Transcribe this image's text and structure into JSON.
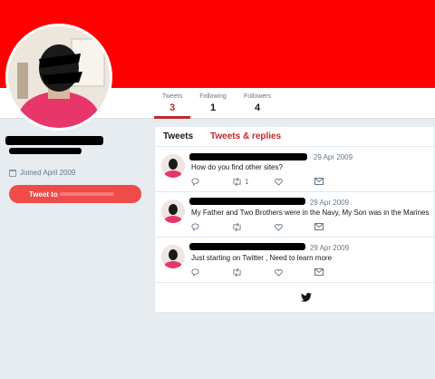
{
  "profile": {
    "joined": "Joined April 2009",
    "tweet_to_label": "Tweet to"
  },
  "nav": {
    "stats": [
      {
        "label": "Tweets",
        "value": "3"
      },
      {
        "label": "Following",
        "value": "1"
      },
      {
        "label": "Followers",
        "value": "4"
      }
    ]
  },
  "timeline": {
    "tabs": [
      "Tweets",
      "Tweets & replies"
    ],
    "tweets": [
      {
        "date": "· 29 Apr 2009",
        "text": "How do you find other sites?",
        "retweets": "1"
      },
      {
        "date": "· 29 Apr 2009",
        "text": "My Father and Two Brothers were in the Navy, My Son was in the Marines",
        "retweets": ""
      },
      {
        "date": "· 29 Apr 2009",
        "text": "Just  starting on Twitter , Need to learn more",
        "retweets": ""
      }
    ]
  },
  "colors": {
    "banner": "#ff0000",
    "accent": "#c0282a",
    "button": "#ef4b4b"
  },
  "icons": {
    "reply": "reply-icon",
    "retweet": "retweet-icon",
    "like": "heart-icon",
    "message": "envelope-icon",
    "brand": "twitter-bird-icon"
  }
}
